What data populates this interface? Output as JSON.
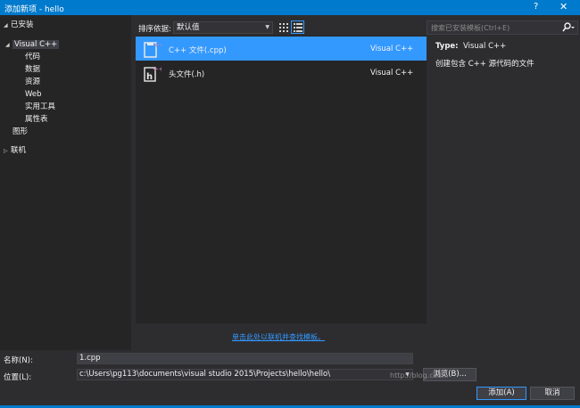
{
  "window": {
    "title": "添加新项 - hello",
    "help": "?",
    "close": "✕"
  },
  "tree": {
    "installed": "已安装",
    "visual_cpp": "Visual C++",
    "children": [
      "代码",
      "数据",
      "资源",
      "Web",
      "实用工具",
      "属性表"
    ],
    "graphics": "图形",
    "online": "联机"
  },
  "toolbar": {
    "sort_label": "排序依据:",
    "sort_value": "默认值"
  },
  "search": {
    "placeholder": "搜索已安装模板(Ctrl+E)"
  },
  "templates": [
    {
      "name": "C++ 文件(.cpp)",
      "language": "Visual C++",
      "icon": "cpp-file-icon",
      "selected": true
    },
    {
      "name": "头文件(.h)",
      "language": "Visual C++",
      "icon": "header-file-icon",
      "selected": false
    }
  ],
  "details": {
    "type_label": "Type:",
    "type_value": "Visual C++",
    "description": "创建包含 C++ 源代码的文件"
  },
  "online_link": "单击此处以联机并查找模板。",
  "form": {
    "name_label": "名称(N):",
    "name_value": "1.cpp",
    "location_label": "位置(L):",
    "location_value": "c:\\Users\\pg113\\documents\\visual studio 2015\\Projects\\hello\\hello\\",
    "browse": "浏览(B)...",
    "add": "添加(A)",
    "cancel": "取消"
  },
  "watermark": "http://blog.csdn.",
  "colors": {
    "accent": "#007acc",
    "selection": "#3399ff",
    "background": "#2d2d30",
    "panel": "#252526"
  }
}
